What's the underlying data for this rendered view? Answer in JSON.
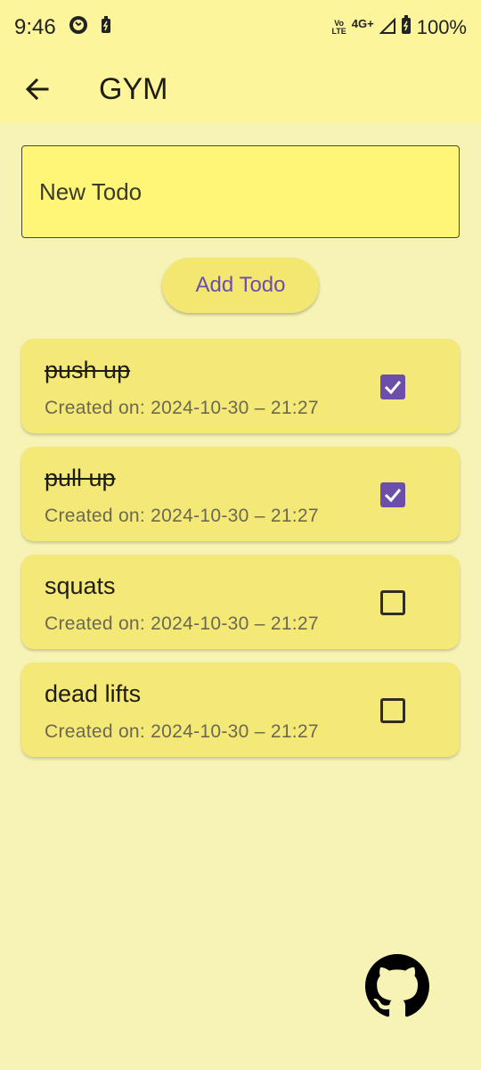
{
  "status_bar": {
    "time": "9:46",
    "network_top": "Vo",
    "network_bottom": "LTE",
    "net_type": "4G+",
    "battery": "100%"
  },
  "app_bar": {
    "title": "GYM"
  },
  "input": {
    "placeholder": "New Todo"
  },
  "add_button": {
    "label": "Add Todo"
  },
  "todos": [
    {
      "title": "push up",
      "date": "Created on: 2024-10-30 – 21:27",
      "done": true
    },
    {
      "title": "pull up",
      "date": "Created on: 2024-10-30 – 21:27",
      "done": true
    },
    {
      "title": "squats",
      "date": "Created on: 2024-10-30 – 21:27",
      "done": false
    },
    {
      "title": "dead lifts",
      "date": "Created on: 2024-10-30 – 21:27",
      "done": false
    }
  ],
  "colors": {
    "app_bar": "#fdf59c",
    "background": "#f6f3b5",
    "card": "#f4e877",
    "accent": "#6b4fa8"
  },
  "icons": {
    "back": "arrow-back-icon",
    "github": "github-icon"
  }
}
